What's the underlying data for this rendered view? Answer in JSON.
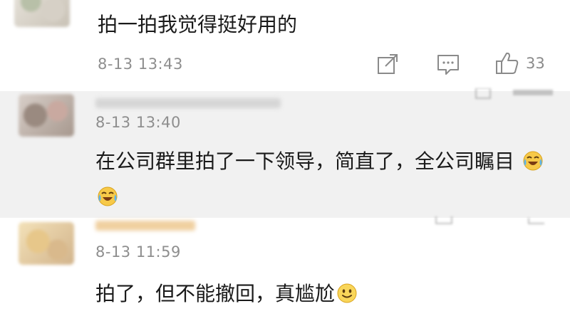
{
  "comments": [
    {
      "text": "拍一拍我觉得挺好用的",
      "time": "8-13 13:43",
      "actions": {
        "share_icon": "share-icon",
        "comment_icon": "comment-icon",
        "like_icon": "thumbs-up-icon",
        "like_count": "33"
      }
    },
    {
      "time": "8-13 13:40",
      "text": "在公司群里拍了一下领导，简直了，全公司瞩目",
      "emojis": [
        "tears-of-joy-emoji",
        "tears-of-joy-emoji"
      ]
    },
    {
      "time": "8-13 11:59",
      "text": "拍了，但不能撤回，真尴尬",
      "emojis": [
        "smile-emoji"
      ]
    }
  ],
  "colors": {
    "highlight_bg": "#f1f1f1",
    "meta_text": "#8e8e8e",
    "body_text": "#1a1a1a"
  }
}
